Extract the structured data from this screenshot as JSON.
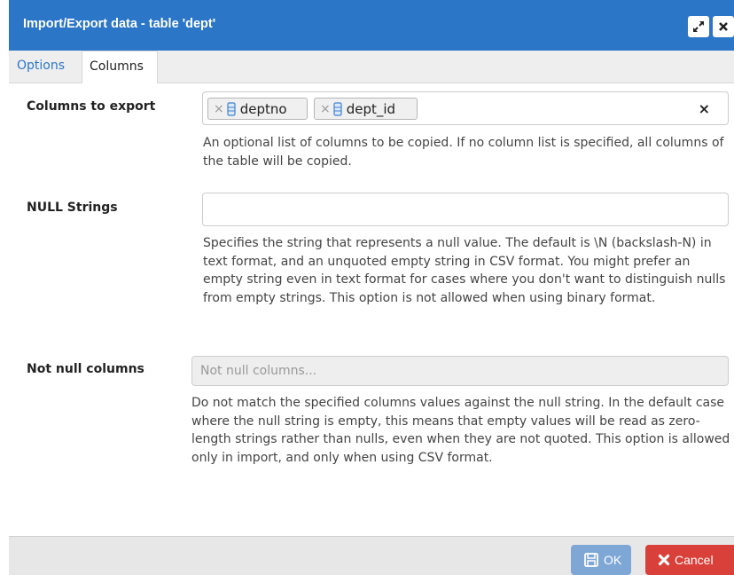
{
  "dialog": {
    "title": "Import/Export data - table 'dept'"
  },
  "tabs": [
    {
      "label": "Options",
      "active": false
    },
    {
      "label": "Columns",
      "active": true
    }
  ],
  "columns_to_export": {
    "label": "Columns to export",
    "selected": [
      "deptno",
      "dept_id"
    ],
    "clear_symbol": "×",
    "help": "An optional list of columns to be copied. If no column list is specified, all columns of the table will be copied."
  },
  "null_strings": {
    "label": "NULL Strings",
    "value": "",
    "help": "Specifies the string that represents a null value. The default is \\N (backslash-N) in text format, and an unquoted empty string in CSV format. You might prefer an empty string even in text format for cases where you don't want to distinguish nulls from empty strings. This option is not allowed when using binary format."
  },
  "not_null_columns": {
    "label": "Not null columns",
    "placeholder": "Not null columns...",
    "help": "Do not match the specified columns values against the null string. In the default case where the null string is empty, this means that empty values will be read as zero-length strings rather than nulls, even when they are not quoted. This option is allowed only in import, and only when using CSV format."
  },
  "footer": {
    "ok_label": "OK",
    "cancel_label": "Cancel"
  },
  "colors": {
    "titlebar": "#2c76c7",
    "ok": "#7fa7d6",
    "cancel": "#d9403a"
  },
  "icons": {
    "expand": "expand-icon",
    "close": "close-icon",
    "column": "column-icon",
    "save": "save-icon",
    "cancel": "x-icon"
  }
}
